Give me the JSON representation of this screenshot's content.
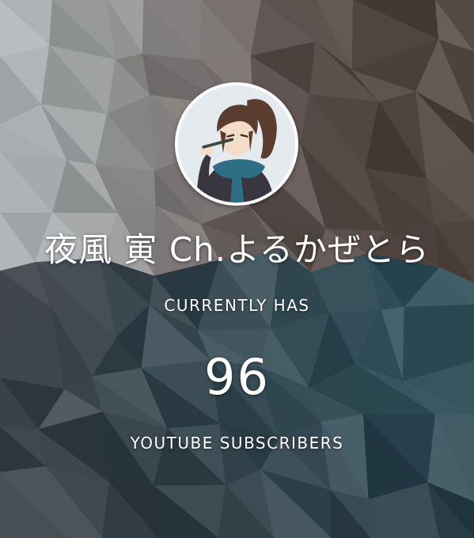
{
  "channel": {
    "name": "夜風 寅 Ch.よるかぜとら",
    "avatar_icon": "channel-avatar-icon"
  },
  "stats": {
    "label_top": "CURRENTLY HAS",
    "subscriber_count": "96",
    "label_bottom": "YOUTUBE SUBSCRIBERS"
  },
  "colors": {
    "text": "#ffffff",
    "avatar_border": "#ffffff",
    "scarf": "#2f6f85"
  }
}
